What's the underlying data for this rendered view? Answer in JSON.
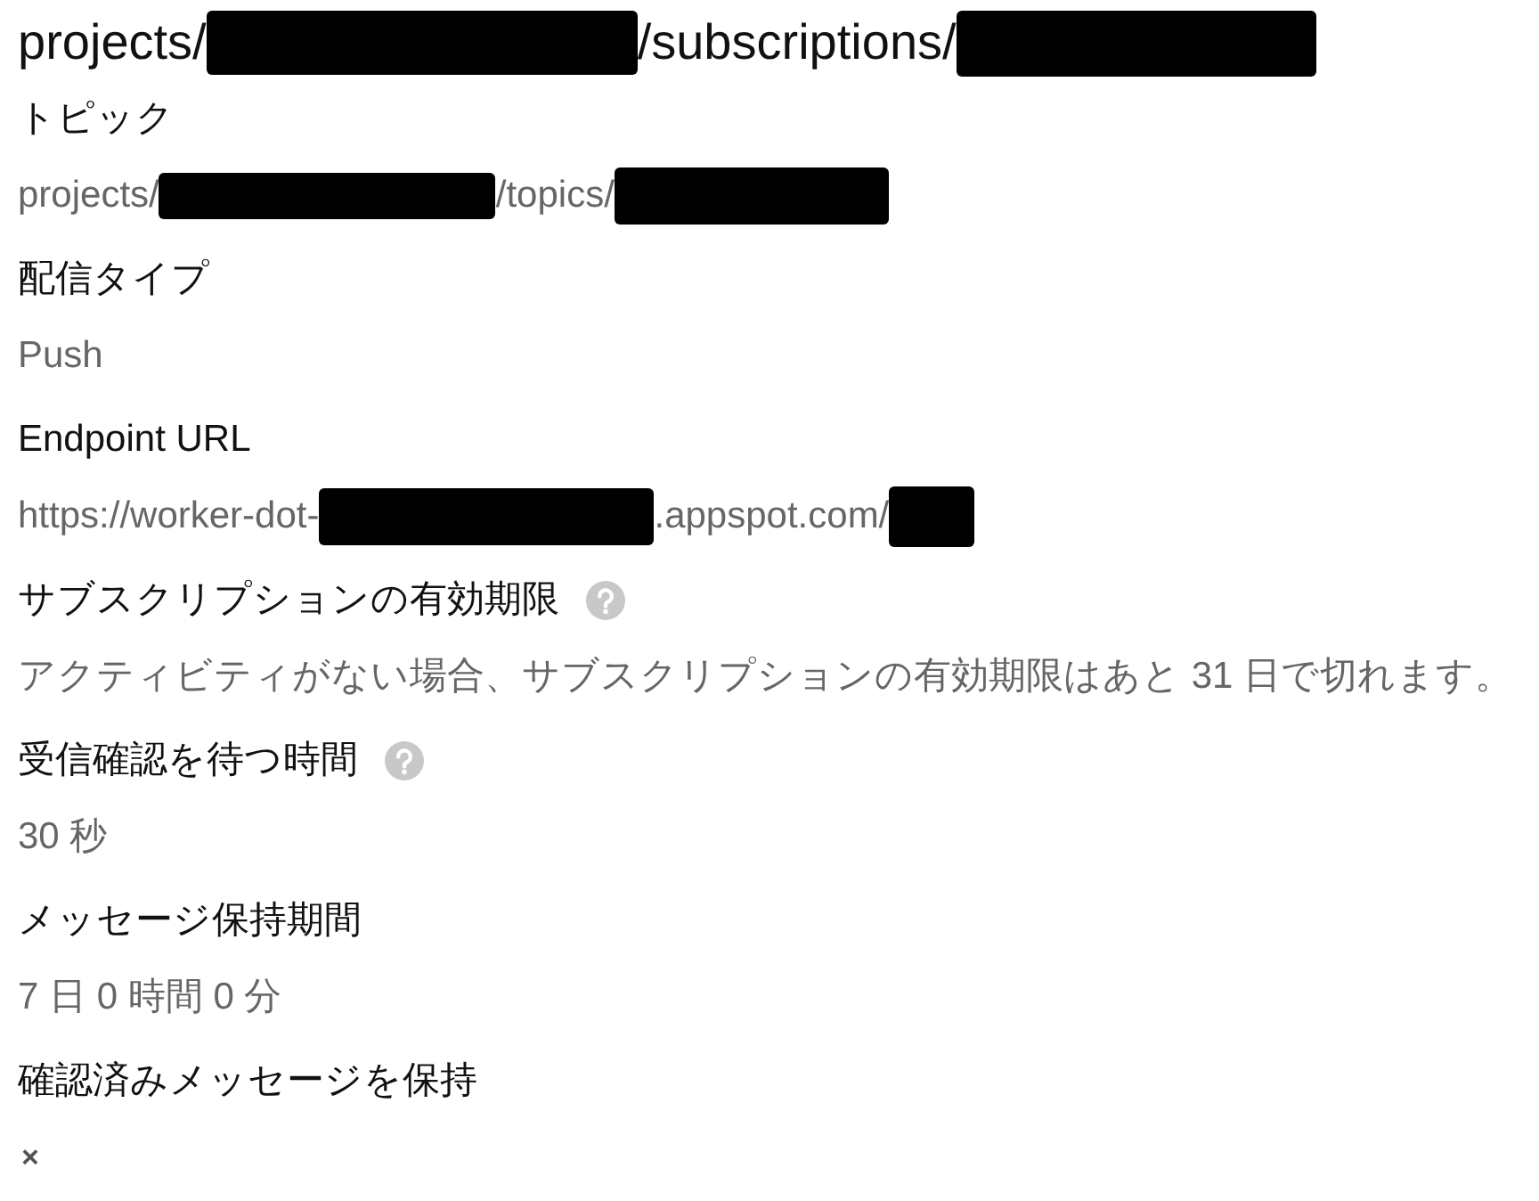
{
  "title": {
    "parts": [
      {
        "kind": "text",
        "text": "projects/"
      },
      {
        "kind": "redacted"
      },
      {
        "kind": "text",
        "text": "/subscriptions/"
      },
      {
        "kind": "redacted"
      }
    ]
  },
  "fields": [
    {
      "label": "トピック",
      "help": false,
      "value": [
        {
          "kind": "text",
          "text": "projects/"
        },
        {
          "kind": "redacted"
        },
        {
          "kind": "text",
          "text": "/topics/"
        },
        {
          "kind": "redacted"
        }
      ]
    },
    {
      "label": "配信タイプ",
      "help": false,
      "value": [
        {
          "kind": "text",
          "text": "Push"
        }
      ]
    },
    {
      "label": "Endpoint URL",
      "help": false,
      "value": [
        {
          "kind": "text",
          "text": "https://worker-dot-"
        },
        {
          "kind": "redacted"
        },
        {
          "kind": "text",
          "text": ".appspot.com/"
        },
        {
          "kind": "redacted"
        }
      ]
    },
    {
      "label": "サブスクリプションの有効期限",
      "help": true,
      "value": [
        {
          "kind": "text",
          "text": "アクティビティがない場合、サブスクリプションの有効期限はあと 31 日で切れます。"
        }
      ]
    },
    {
      "label": "受信確認を待つ時間",
      "help": true,
      "value": [
        {
          "kind": "text",
          "text": "30 秒"
        }
      ]
    },
    {
      "label": "メッセージ保持期間",
      "help": false,
      "value": [
        {
          "kind": "text",
          "text": "7 日 0 時間 0 分"
        }
      ]
    },
    {
      "label": "確認済みメッセージを保持",
      "help": false,
      "value": [
        {
          "kind": "mark",
          "text": "×"
        }
      ]
    }
  ]
}
